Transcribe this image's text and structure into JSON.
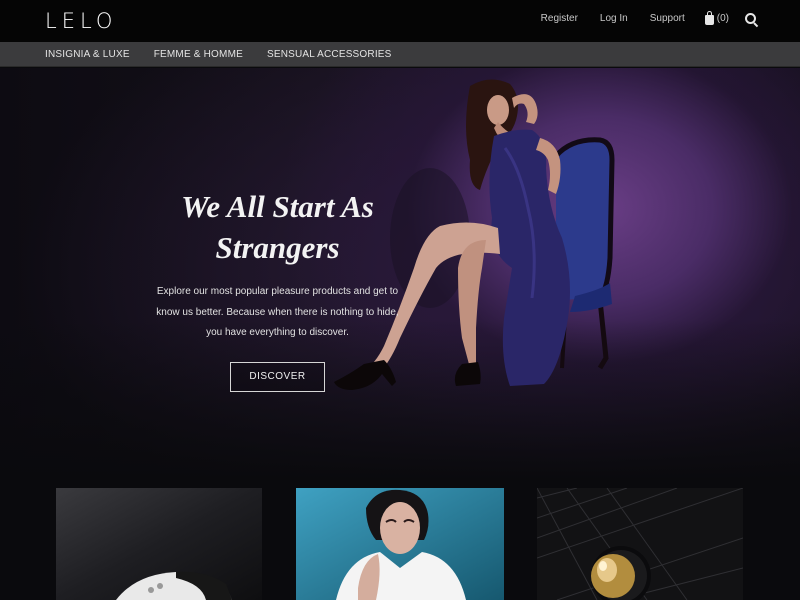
{
  "brand": {
    "logo": "LELO"
  },
  "header": {
    "links": [
      "Register",
      "Log In",
      "Support"
    ],
    "cart_count": "(0)",
    "icons": {
      "cart": "shopping-bag-icon",
      "search": "search-icon"
    }
  },
  "nav": {
    "items": [
      "INSIGNIA & LUXE",
      "FEMME & HOMME",
      "SENSUAL ACCESSORIES"
    ]
  },
  "hero": {
    "title_line1": "We All Start As",
    "title_line2": "Strangers",
    "text_line1": "Explore our most popular pleasure products and get to",
    "text_line2": "know us better. Because when there is nothing to hide,",
    "text_line3": "you have everything to discover.",
    "button": "DISCOVER"
  },
  "colors": {
    "background": "#0a0a0d",
    "topbar": "#050505",
    "navbar": "#3b3b3d",
    "hero_accent": "#6a3e86",
    "dress": "#2a2668"
  }
}
